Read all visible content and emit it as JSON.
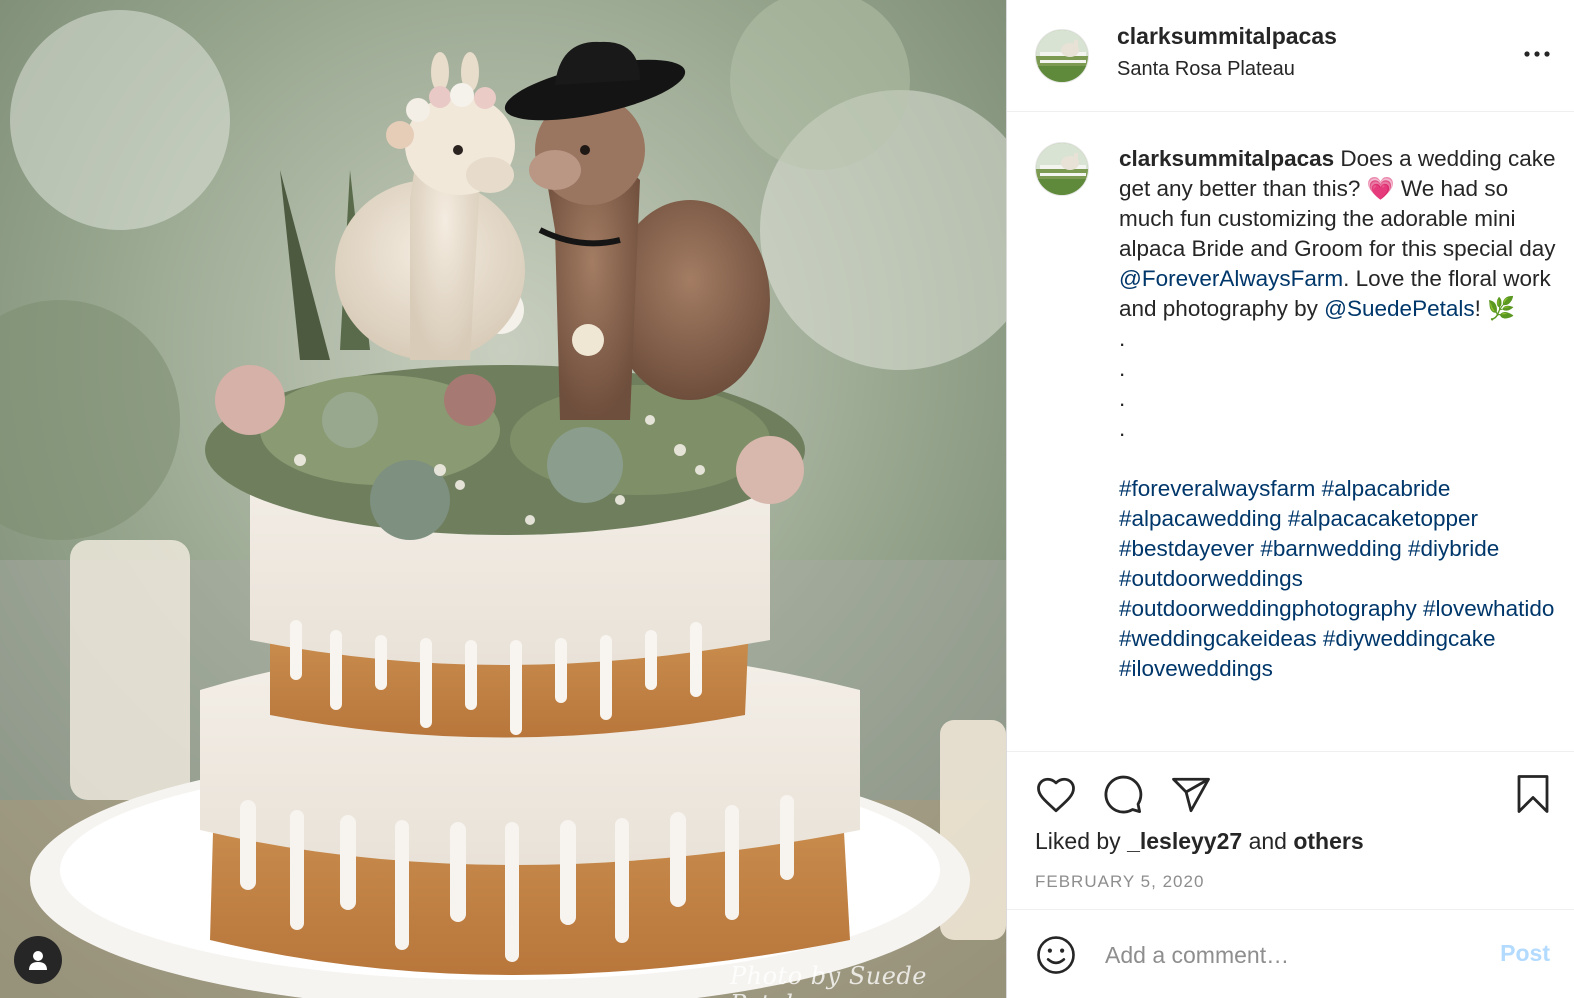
{
  "post": {
    "username": "clarksummitalpacas",
    "location": "Santa Rosa Plateau",
    "photo_watermark": "Photo by Suede Petals",
    "caption": {
      "username": "clarksummitalpacas",
      "text_1": " Does a wedding cake get any better than this? 💗 We had so much fun customizing the adorable mini alpaca Bride and Groom for this special day ",
      "mention_1": "@ForeverAlwaysFarm",
      "text_2": ". Love the floral work and photography by ",
      "mention_2": "@SuedePetals",
      "text_3": "! 🌿",
      "dots": [
        ".",
        ".",
        ".",
        "."
      ],
      "hashtags": [
        "#foreveralwaysfarm",
        "#alpacabride",
        "#alpacawedding",
        "#alpacacaketopper",
        "#bestdayever",
        "#barnwedding",
        "#diybride",
        "#outdoorweddings",
        "#outdoorweddingphotography",
        "#lovewhatido",
        "#weddingcakeideas",
        "#diyweddingcake",
        "#iloveweddings"
      ]
    },
    "likes": {
      "prefix": "Liked by ",
      "user": "_lesleyy27",
      "middle": " and ",
      "others": "others"
    },
    "date": "FEBRUARY 5, 2020",
    "comment_placeholder": "Add a comment…",
    "post_label": "Post"
  },
  "icons": {
    "more": "more-options-icon",
    "like": "heart-icon",
    "comment": "comment-bubble-icon",
    "share": "paper-plane-icon",
    "save": "bookmark-icon",
    "emoji": "smiley-icon",
    "tagged_user": "user-icon"
  },
  "colors": {
    "link": "#00376b",
    "post_button_disabled": "#b3dbff",
    "muted": "#8e8e8e"
  }
}
